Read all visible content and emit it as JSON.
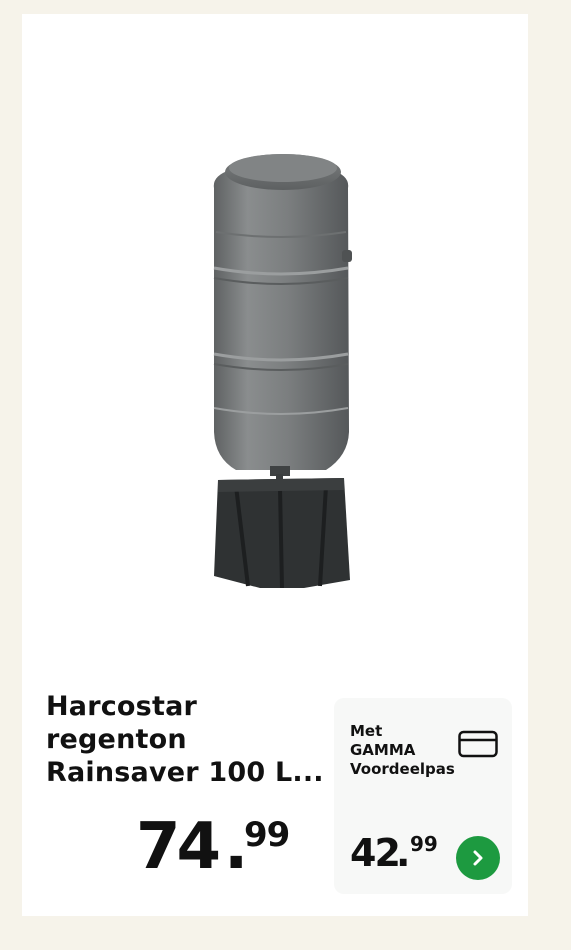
{
  "product": {
    "title_lines": [
      "Harcostar",
      "regenton",
      "Rainsaver 100 L..."
    ],
    "image_icon": "rain-barrel-image"
  },
  "price": {
    "integer": "74",
    "separator": ".",
    "decimals": "99"
  },
  "membership": {
    "label_lines": [
      "Met",
      "GAMMA",
      "Voordeelpas"
    ],
    "card_icon": "card-icon",
    "price": {
      "integer": "42",
      "separator": ".",
      "decimals": "99"
    },
    "action_icon": "chevron-right-icon"
  },
  "colors": {
    "accent_green": "#1d9a40",
    "page_background": "#f6f3ea",
    "card_background": "#ffffff",
    "member_box_background": "#f7f8f7"
  }
}
